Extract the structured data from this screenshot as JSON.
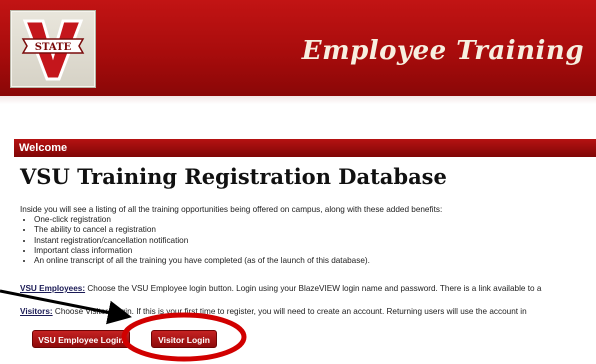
{
  "header": {
    "logo_text": "STATE",
    "logo_letter": "V",
    "title": "Employee Training"
  },
  "welcome_bar": {
    "label": "Welcome"
  },
  "main": {
    "heading": "VSU Training Registration Database",
    "intro": "Inside you will see a listing of all the training opportunities being offered on campus, along with these added benefits:",
    "benefits": [
      "One-click registration",
      "The ability to cancel a registration",
      "Instant registration/cancellation notification",
      "Important class information",
      "An online transcript of all the training you have completed (as of the launch of this database)."
    ],
    "employees_lead": "VSU Employees:",
    "employees_text": " Choose the VSU Employee login button. Login using your BlazeVIEW login name and password. There is a link available to a",
    "visitors_lead": "Visitors:",
    "visitors_text": " Choose Visitors login. If this is your first time to register, you will need to create an account. Returning users will use the account in"
  },
  "buttons": {
    "employee_login": "VSU Employee Login",
    "visitor_login": "Visitor Login"
  },
  "colors": {
    "header_red": "#b30f0f",
    "annotation_red": "#d10000",
    "arrow": "#000000"
  }
}
